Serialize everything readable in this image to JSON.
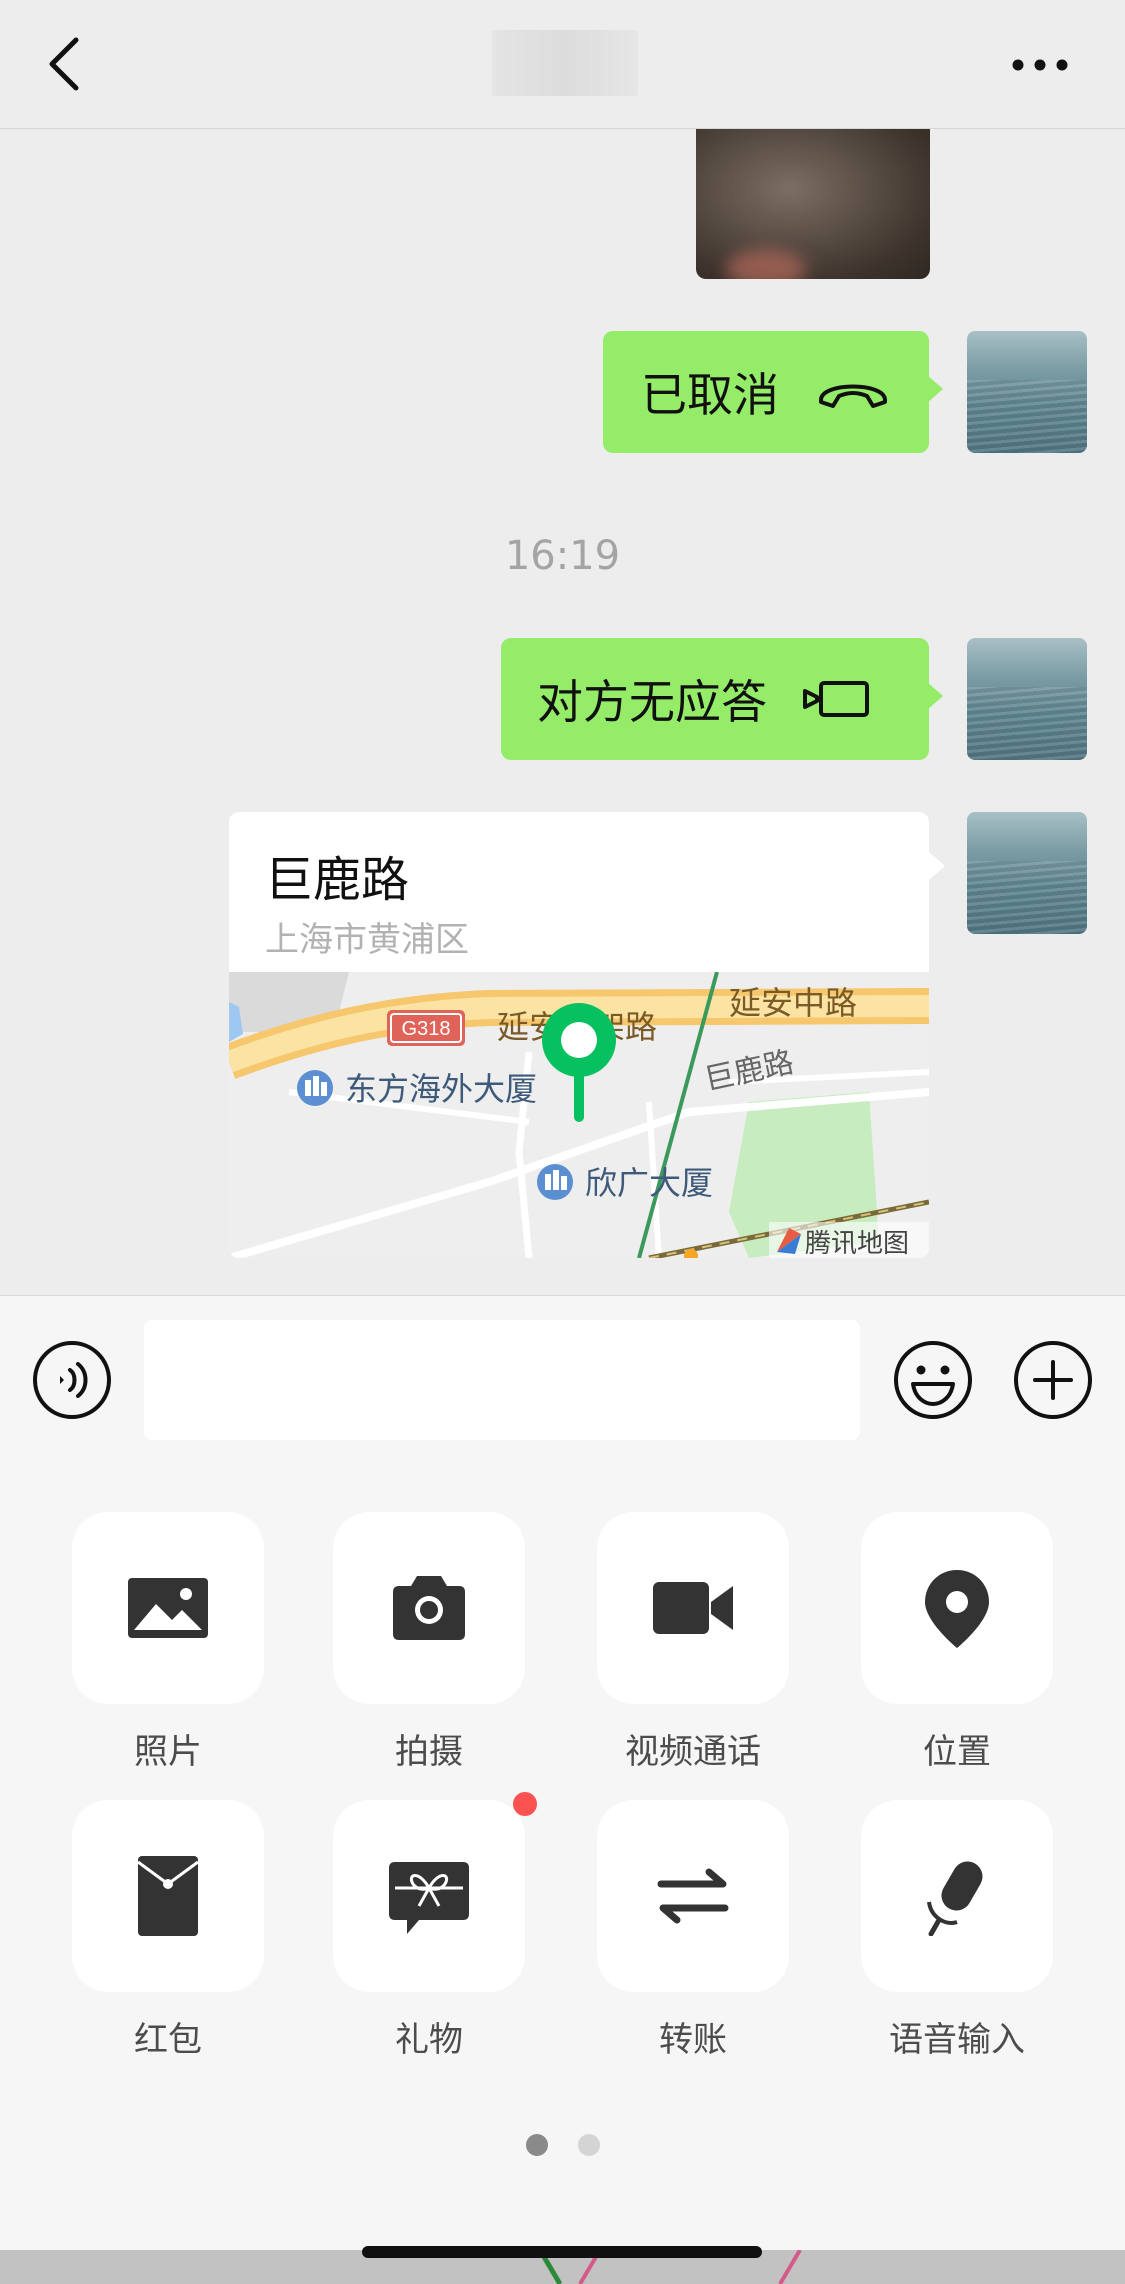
{
  "header": {
    "back_icon": "chevron-left-icon",
    "more_icon": "more-dots-icon"
  },
  "messages": [
    {
      "type": "call",
      "text": "已取消",
      "icon": "hangup-icon"
    },
    {
      "type": "time",
      "text": "16:19"
    },
    {
      "type": "call",
      "text": "对方无应答",
      "icon": "video-call-icon"
    }
  ],
  "location": {
    "name": "巨鹿路",
    "address": "上海市黄浦区",
    "map": {
      "highway_badge": "G318",
      "road1": "延安高架路",
      "road2": "延安中路",
      "road3": "巨鹿路",
      "poi1": "东方海外大厦",
      "poi2": "欣广大厦",
      "brand": "腾讯地图"
    }
  },
  "input": {
    "placeholder": "",
    "value": ""
  },
  "panel": {
    "items": [
      {
        "label": "照片",
        "icon": "photo-icon"
      },
      {
        "label": "拍摄",
        "icon": "camera-icon"
      },
      {
        "label": "视频通话",
        "icon": "video-icon"
      },
      {
        "label": "位置",
        "icon": "location-icon"
      },
      {
        "label": "红包",
        "icon": "red-packet-icon"
      },
      {
        "label": "礼物",
        "icon": "gift-icon"
      },
      {
        "label": "转账",
        "icon": "transfer-icon"
      },
      {
        "label": "语音输入",
        "icon": "microphone-icon"
      }
    ],
    "page_count": 2,
    "current_page": 1
  },
  "colors": {
    "bubble": "#95ec69",
    "background": "#ededed",
    "map_pin": "#07c160",
    "badge": "#fa5151"
  }
}
